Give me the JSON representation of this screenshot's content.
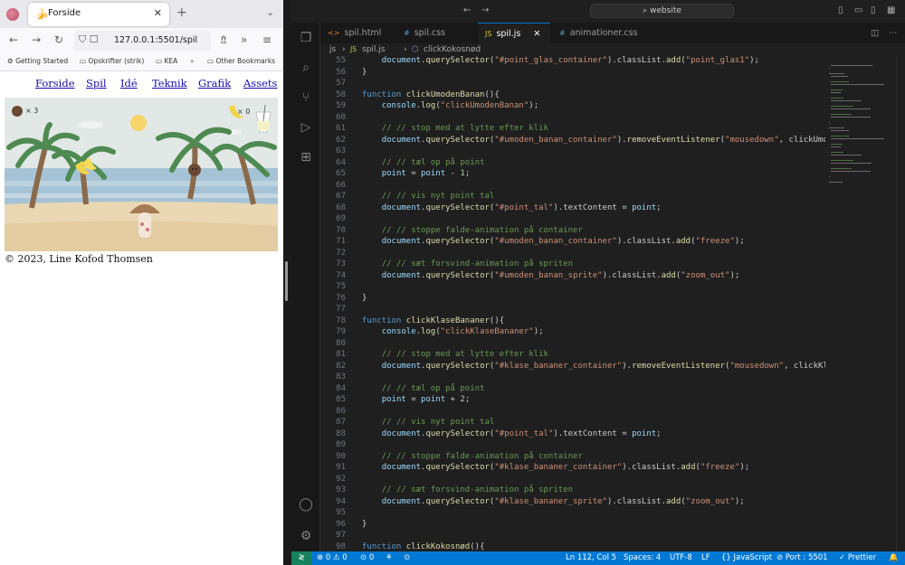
{
  "browser": {
    "tab_title": "Forside",
    "url": "127.0.0.1:5501/spil",
    "bookmarks": [
      "Getting Started",
      "Opskrifter (strik)",
      "KEA",
      "Other Bookmarks"
    ],
    "site_nav": [
      "Forside",
      "Spil",
      "Idé",
      "Teknik",
      "Grafik",
      "Assets"
    ],
    "game": {
      "coconut_count": "× 3",
      "banana_count": "× 0"
    },
    "copyright": "© 2023, Line Kofod Thomsen"
  },
  "editor": {
    "search_text": "website",
    "tabs": [
      {
        "label": "spil.html",
        "icon": "<>",
        "active": false
      },
      {
        "label": "spil.css",
        "icon": "#",
        "active": false
      },
      {
        "label": "spil.js",
        "icon": "JS",
        "active": true
      },
      {
        "label": "animationer.css",
        "icon": "#",
        "active": false
      }
    ],
    "breadcrumb": {
      "folder": "js",
      "file": "spil.js",
      "symbol": "clickKokosnød"
    },
    "code_lines": [
      {
        "n": "55",
        "t": "    document.querySelector(\"#point_glas_container\").classList.add(\"point_glas1\");"
      },
      {
        "n": "56",
        "t": "}"
      },
      {
        "n": "57",
        "t": ""
      },
      {
        "n": "58",
        "t": "function clickUmodenBanan(){"
      },
      {
        "n": "59",
        "t": "    console.log(\"clickUmodenBanan\");"
      },
      {
        "n": "60",
        "t": ""
      },
      {
        "n": "61",
        "t": "    // // stop med at lytte efter klik"
      },
      {
        "n": "62",
        "t": "    document.querySelector(\"#umoden_banan_container\").removeEventListener(\"mousedown\", clickUmodenBanan"
      },
      {
        "n": "63",
        "t": ""
      },
      {
        "n": "64",
        "t": "    // // tæl op på point"
      },
      {
        "n": "65",
        "t": "    point = point - 1;"
      },
      {
        "n": "66",
        "t": ""
      },
      {
        "n": "67",
        "t": "    // // vis nyt point tal"
      },
      {
        "n": "68",
        "t": "    document.querySelector(\"#point_tal\").textContent = point;"
      },
      {
        "n": "69",
        "t": ""
      },
      {
        "n": "70",
        "t": "    // // stoppe falde-animation på container"
      },
      {
        "n": "71",
        "t": "    document.querySelector(\"#umoden_banan_container\").classList.add(\"freeze\");"
      },
      {
        "n": "72",
        "t": ""
      },
      {
        "n": "73",
        "t": "    // // sæt forsvind-animation på spriten"
      },
      {
        "n": "74",
        "t": "    document.querySelector(\"#umoden_banan_sprite\").classList.add(\"zoom_out\");"
      },
      {
        "n": "75",
        "t": ""
      },
      {
        "n": "76",
        "t": "}"
      },
      {
        "n": "77",
        "t": ""
      },
      {
        "n": "78",
        "t": "function clickKlaseBananer(){"
      },
      {
        "n": "79",
        "t": "    console.log(\"clickKlaseBananer\");"
      },
      {
        "n": "80",
        "t": ""
      },
      {
        "n": "81",
        "t": "    // // stop med at lytte efter klik"
      },
      {
        "n": "82",
        "t": "    document.querySelector(\"#klase_bananer_container\").removeEventListener(\"mousedown\", clickKlaseBanan"
      },
      {
        "n": "83",
        "t": ""
      },
      {
        "n": "84",
        "t": "    // // tæl op på point"
      },
      {
        "n": "85",
        "t": "    point = point + 2;"
      },
      {
        "n": "86",
        "t": ""
      },
      {
        "n": "87",
        "t": "    // // vis nyt point tal"
      },
      {
        "n": "88",
        "t": "    document.querySelector(\"#point_tal\").textContent = point;"
      },
      {
        "n": "89",
        "t": ""
      },
      {
        "n": "90",
        "t": "    // // stoppe falde-animation på container"
      },
      {
        "n": "91",
        "t": "    document.querySelector(\"#klase_bananer_container\").classList.add(\"freeze\");"
      },
      {
        "n": "92",
        "t": ""
      },
      {
        "n": "93",
        "t": "    // // sæt forsvind-animation på spriten"
      },
      {
        "n": "94",
        "t": "    document.querySelector(\"#klase_bananer_sprite\").classList.add(\"zoom_out\");"
      },
      {
        "n": "95",
        "t": ""
      },
      {
        "n": "96",
        "t": "}"
      },
      {
        "n": "97",
        "t": ""
      },
      {
        "n": "98",
        "t": "function clickKokosnød(){"
      }
    ],
    "status": {
      "errors": "⊗ 0 ⚠ 0",
      "ports": "⊙ 0",
      "position": "Ln 112, Col 5",
      "spaces": "Spaces: 4",
      "encoding": "UTF-8",
      "eol": "LF",
      "language": "{} JavaScript",
      "port": "⊘ Port : 5501",
      "prettier": "✓ Prettier"
    }
  }
}
